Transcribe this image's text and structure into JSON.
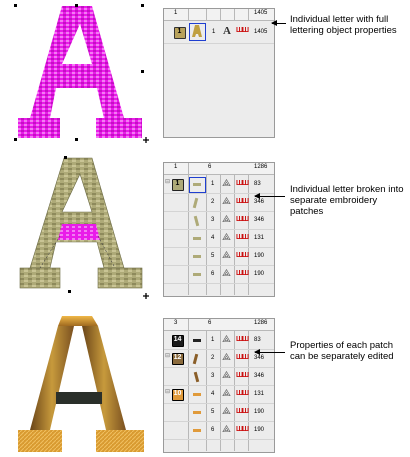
{
  "panel1": {
    "header": [
      "1",
      "1405"
    ],
    "rows": [
      {
        "index": "1",
        "object_num": "1",
        "stitches": "1405",
        "icon": "lettering-a-icon",
        "badge_color": "#b8a25b"
      }
    ],
    "annotation": "Individual letter with full lettering object properties"
  },
  "panel2": {
    "header": [
      "1",
      "6",
      "1286"
    ],
    "rows": [
      {
        "index": "1",
        "stitches": "83",
        "badge": "1"
      },
      {
        "index": "2",
        "stitches": "346"
      },
      {
        "index": "3",
        "stitches": "346"
      },
      {
        "index": "4",
        "stitches": "131"
      },
      {
        "index": "5",
        "stitches": "190"
      },
      {
        "index": "6",
        "stitches": "190"
      }
    ],
    "annotation": "Individual letter broken into separate embroidery patches"
  },
  "panel3": {
    "header": [
      "3",
      "6",
      "1286"
    ],
    "rows": [
      {
        "index": "1",
        "stitches": "83",
        "badge": "14",
        "badge_color": "#1a1a1a"
      },
      {
        "index": "2",
        "stitches": "346",
        "badge": "12",
        "badge_color": "#8a6a3c"
      },
      {
        "index": "3",
        "stitches": "346"
      },
      {
        "index": "4",
        "stitches": "131",
        "badge": "10",
        "badge_color": "#e09a3a"
      },
      {
        "index": "5",
        "stitches": "190"
      },
      {
        "index": "6",
        "stitches": "190"
      }
    ],
    "annotation": "Properties of each patch can be separately edited"
  },
  "colors": {
    "magenta": "#e91be9",
    "khaki": "#aeaa78",
    "gold": "#c79a3c",
    "bronze": "#8a5e28",
    "selection": "#1f3fd0",
    "thread_red": "#cc1010"
  }
}
